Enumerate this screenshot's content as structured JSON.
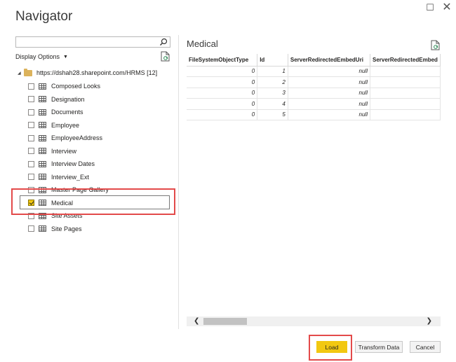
{
  "window": {
    "title": "Navigator",
    "restore_glyph": "☐",
    "close_glyph": "✕"
  },
  "left_pane": {
    "search": {
      "value": "",
      "placeholder": ""
    },
    "display_options_label": "Display Options",
    "root": {
      "label": "https://dshah28.sharepoint.com/HRMS [12]"
    },
    "items": [
      {
        "label": "Composed Looks",
        "checked": false
      },
      {
        "label": "Designation",
        "checked": false
      },
      {
        "label": "Documents",
        "checked": false
      },
      {
        "label": "Employee",
        "checked": false
      },
      {
        "label": "EmployeeAddress",
        "checked": false
      },
      {
        "label": "Interview",
        "checked": false
      },
      {
        "label": "Interview Dates",
        "checked": false
      },
      {
        "label": "Interview_Ext",
        "checked": false
      },
      {
        "label": "Master Page Gallery",
        "checked": false
      },
      {
        "label": "Medical",
        "checked": true
      },
      {
        "label": "Site Assets",
        "checked": false
      },
      {
        "label": "Site Pages",
        "checked": false
      }
    ]
  },
  "preview": {
    "title": "Medical",
    "columns": [
      "FileSystemObjectType",
      "Id",
      "ServerRedirectedEmbedUri",
      "ServerRedirectedEmbed"
    ],
    "rows": [
      [
        "0",
        "1",
        "null",
        ""
      ],
      [
        "0",
        "2",
        "null",
        ""
      ],
      [
        "0",
        "3",
        "null",
        ""
      ],
      [
        "0",
        "4",
        "null",
        ""
      ],
      [
        "0",
        "5",
        "null",
        ""
      ]
    ]
  },
  "footer": {
    "load_label": "Load",
    "transform_label": "Transform Data",
    "cancel_label": "Cancel"
  },
  "colors": {
    "accent_yellow": "#f2c811",
    "highlight_red": "#e34a4a",
    "folder": "#dcb35c"
  },
  "icons": [
    "search-icon",
    "refresh-icon",
    "folder-icon",
    "table-icon",
    "chevron-down-icon"
  ]
}
